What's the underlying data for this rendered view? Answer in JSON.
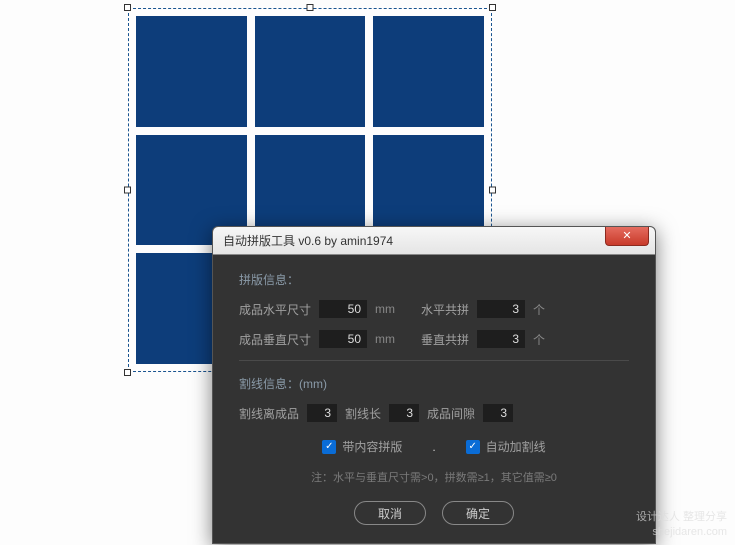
{
  "canvas": {
    "grid_rows": 3,
    "grid_cols": 3,
    "cell_color": "#0d3d7a"
  },
  "dialog": {
    "title": "自动拼版工具 v0.6   by amin1974",
    "section1_title": "拼版信息：",
    "row1": {
      "label_hsize": "成品水平尺寸",
      "value_hsize": "50",
      "unit_mm": "mm",
      "label_hcount": "水平共拼",
      "value_hcount": "3",
      "unit_ge": "个"
    },
    "row2": {
      "label_vsize": "成品垂直尺寸",
      "value_vsize": "50",
      "unit_mm": "mm",
      "label_vcount": "垂直共拼",
      "value_vcount": "3",
      "unit_ge": "个"
    },
    "section2_title": "割线信息：(mm)",
    "row3": {
      "label_offset": "割线离成品",
      "value_offset": "3",
      "label_length": "割线长",
      "value_length": "3",
      "label_gap": "成品间隙",
      "value_gap": "3"
    },
    "checkboxes": {
      "cb1_label": "带内容拼版",
      "cb1_checked": true,
      "separator": ".",
      "cb2_label": "自动加割线",
      "cb2_checked": true
    },
    "note": "注：水平与垂直尺寸需>0，拼数需≥1，其它值需≥0",
    "buttons": {
      "cancel": "取消",
      "ok": "确定"
    }
  },
  "watermark": {
    "line1": "设计达人 整理分享",
    "line2": "shejidaren.com"
  }
}
